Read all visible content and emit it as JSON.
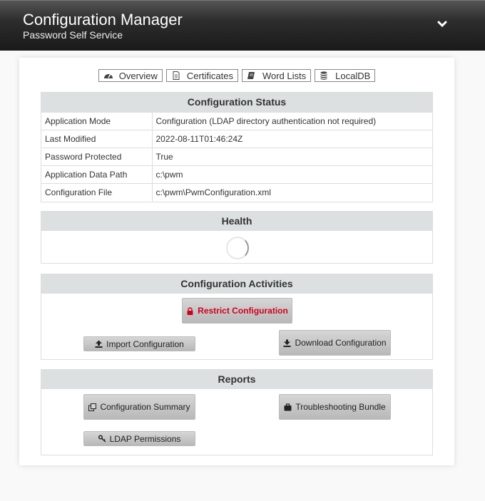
{
  "header": {
    "title": "Configuration Manager",
    "subtitle": "Password Self Service",
    "menu_icon": "chevron-down-icon"
  },
  "nav": {
    "overview": "Overview",
    "certificates": "Certificates",
    "word_lists": "Word Lists",
    "localdb": "LocalDB"
  },
  "status": {
    "title": "Configuration Status",
    "rows": [
      {
        "key": "Application Mode",
        "value": "Configuration (LDAP directory authentication not required)"
      },
      {
        "key": "Last Modified",
        "value": "2022-08-11T01:46:24Z"
      },
      {
        "key": "Password Protected",
        "value": "True"
      },
      {
        "key": "Application Data Path",
        "value": "c:\\pwm"
      },
      {
        "key": "Configuration File",
        "value": "c:\\pwm\\PwmConfiguration.xml"
      }
    ]
  },
  "health": {
    "title": "Health"
  },
  "activities": {
    "title": "Configuration Activities",
    "restrict": "Restrict Configuration",
    "import": "Import Configuration",
    "download": "Download Configuration"
  },
  "reports": {
    "title": "Reports",
    "summary": "Configuration Summary",
    "troubleshooting": "Troubleshooting Bundle",
    "ldap_permissions": "LDAP Permissions"
  },
  "colors": {
    "warning": "#d0001c",
    "section_header": "#dce0e0"
  }
}
